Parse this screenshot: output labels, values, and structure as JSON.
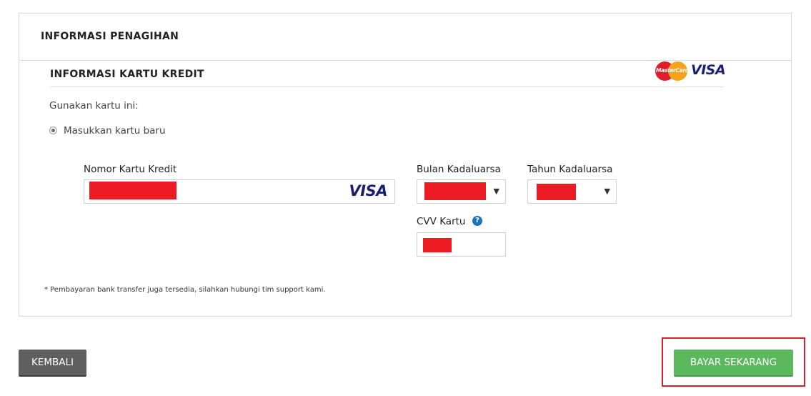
{
  "billing": {
    "title": "INFORMASI PENAGIHAN"
  },
  "credit_card": {
    "section_title": "INFORMASI KARTU KREDIT",
    "accepted_logos": [
      "MasterCard",
      "VISA"
    ],
    "use_card_label": "Gunakan kartu ini:",
    "new_card_option": "Masukkan kartu baru",
    "card_number_label": "Nomor Kartu Kredit",
    "card_brand_detected": "VISA",
    "expiry_month_label": "Bulan Kadaluarsa",
    "expiry_year_label": "Tahun Kadaluarsa",
    "cvv_label": "CVV Kartu",
    "help_icon_glyph": "?"
  },
  "footnote": "* Pembayaran bank transfer juga tersedia, silahkan hubungi tim support kami.",
  "actions": {
    "back_label": "KEMBALI",
    "pay_label": "BAYAR SEKARANG"
  },
  "colors": {
    "pay_button": "#5cb85c",
    "back_button": "#5f5f5f",
    "highlight": "#d6202e",
    "redaction": "#ed1c24",
    "visa_blue": "#1a1f71",
    "help_blue": "#1e73be"
  },
  "icons": {
    "radio": "radio-selected-icon",
    "dropdown": "triangle-down-icon",
    "help": "question-circle-icon"
  }
}
